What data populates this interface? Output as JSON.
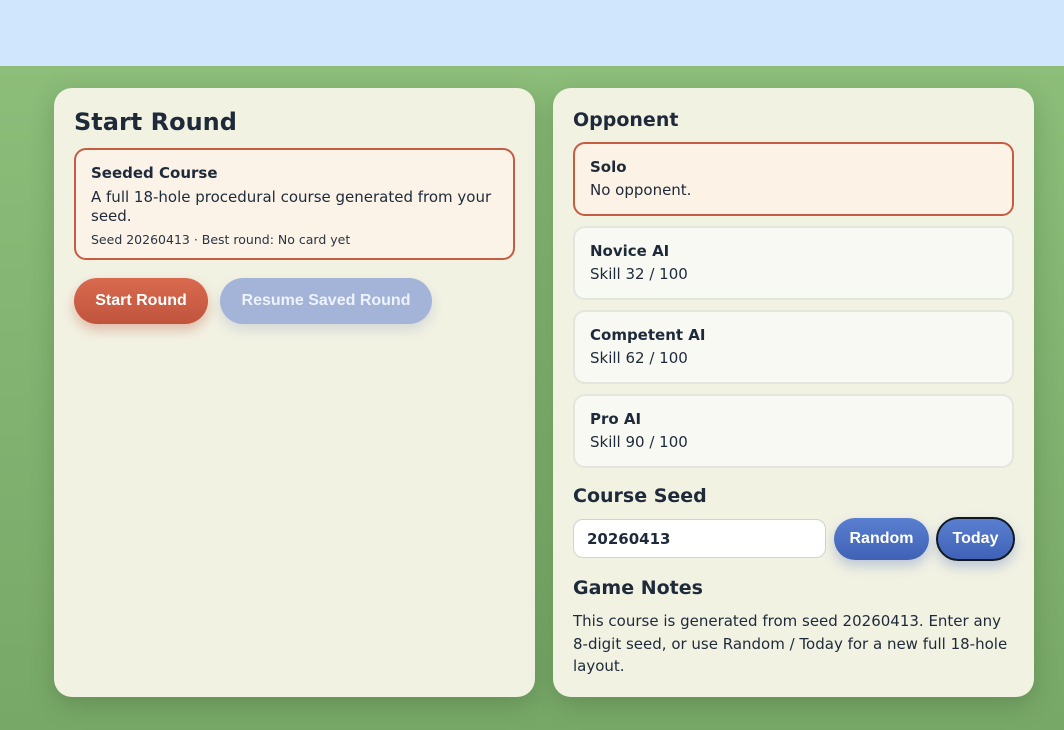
{
  "start": {
    "title": "Start Round",
    "course": {
      "name": "Seeded Course",
      "description": "A full 18-hole procedural course generated from your seed.",
      "meta": "Seed 20260413 · Best round: No card yet"
    },
    "start_button": "Start Round",
    "resume_button": "Resume Saved Round"
  },
  "opponent": {
    "title": "Opponent",
    "options": [
      {
        "name": "Solo",
        "description": "No opponent.",
        "selected": true
      },
      {
        "name": "Novice AI",
        "description": "Skill 32 / 100",
        "selected": false
      },
      {
        "name": "Competent AI",
        "description": "Skill 62 / 100",
        "selected": false
      },
      {
        "name": "Pro AI",
        "description": "Skill 90 / 100",
        "selected": false
      }
    ]
  },
  "seed": {
    "title": "Course Seed",
    "value": "20260413",
    "random_button": "Random",
    "today_button": "Today"
  },
  "notes": {
    "title": "Game Notes",
    "text": "This course is generated from seed 20260413. Enter any 8-digit seed, or use Random / Today for a new full 18-hole layout."
  },
  "colors": {
    "sky": "#d0e6fd",
    "grass": "#8cbd79",
    "panel": "#f2f2e3",
    "accent_red": "#c65d43",
    "accent_blue": "#4a6ec2"
  }
}
